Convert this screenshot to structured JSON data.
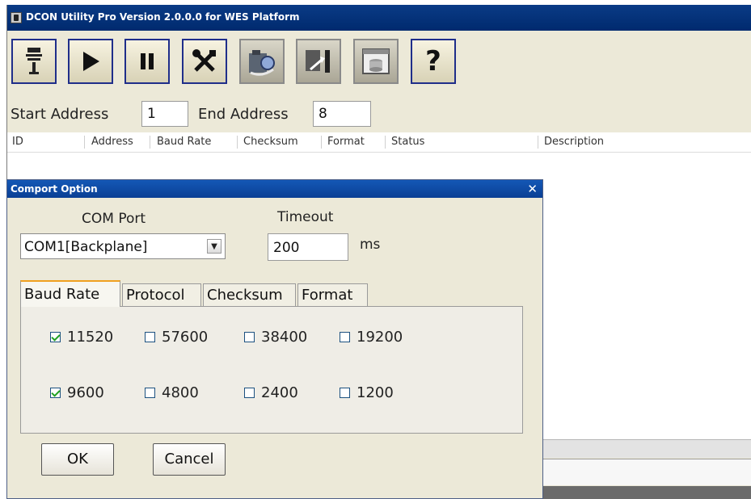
{
  "window": {
    "title": "DCON Utility Pro Version 2.0.0.0 for WES Platform"
  },
  "toolbar": {
    "buttons": [
      {
        "icon": "module-icon"
      },
      {
        "icon": "play-icon"
      },
      {
        "icon": "pause-icon"
      },
      {
        "icon": "tools-icon"
      },
      {
        "icon": "search-module-icon"
      },
      {
        "icon": "transfer-icon"
      },
      {
        "icon": "database-icon"
      },
      {
        "icon": "help-icon",
        "glyph": "?"
      }
    ]
  },
  "address": {
    "start_label": "Start Address",
    "start_value": "1",
    "end_label": "End Address",
    "end_value": "8"
  },
  "grid": {
    "columns": [
      "ID",
      "Address",
      "Baud Rate",
      "Checksum",
      "Format",
      "Status",
      "Description"
    ]
  },
  "dialog": {
    "title": "Comport Option",
    "close_glyph": "✕",
    "com_port_label": "COM Port",
    "com_port_value": "COM1[Backplane]",
    "combo_arrow": "▼",
    "timeout_label": "Timeout",
    "timeout_value": "200",
    "timeout_unit": "ms",
    "tabs": [
      "Baud Rate",
      "Protocol",
      "Checksum",
      "Format"
    ],
    "active_tab": "Baud Rate",
    "baud_rates": [
      {
        "label": "11520",
        "checked": true
      },
      {
        "label": "57600",
        "checked": false
      },
      {
        "label": "38400",
        "checked": false
      },
      {
        "label": "19200",
        "checked": false
      },
      {
        "label": "9600",
        "checked": true
      },
      {
        "label": "4800",
        "checked": false
      },
      {
        "label": "2400",
        "checked": false
      },
      {
        "label": "1200",
        "checked": false
      }
    ],
    "ok_label": "OK",
    "cancel_label": "Cancel"
  },
  "colors": {
    "titlebar": "#0a3b86",
    "dialog_titlebar": "#1458b6",
    "toolbar_border": "#1f2e8a",
    "tab_accent": "#f0a020",
    "check_green": "#21a121"
  }
}
